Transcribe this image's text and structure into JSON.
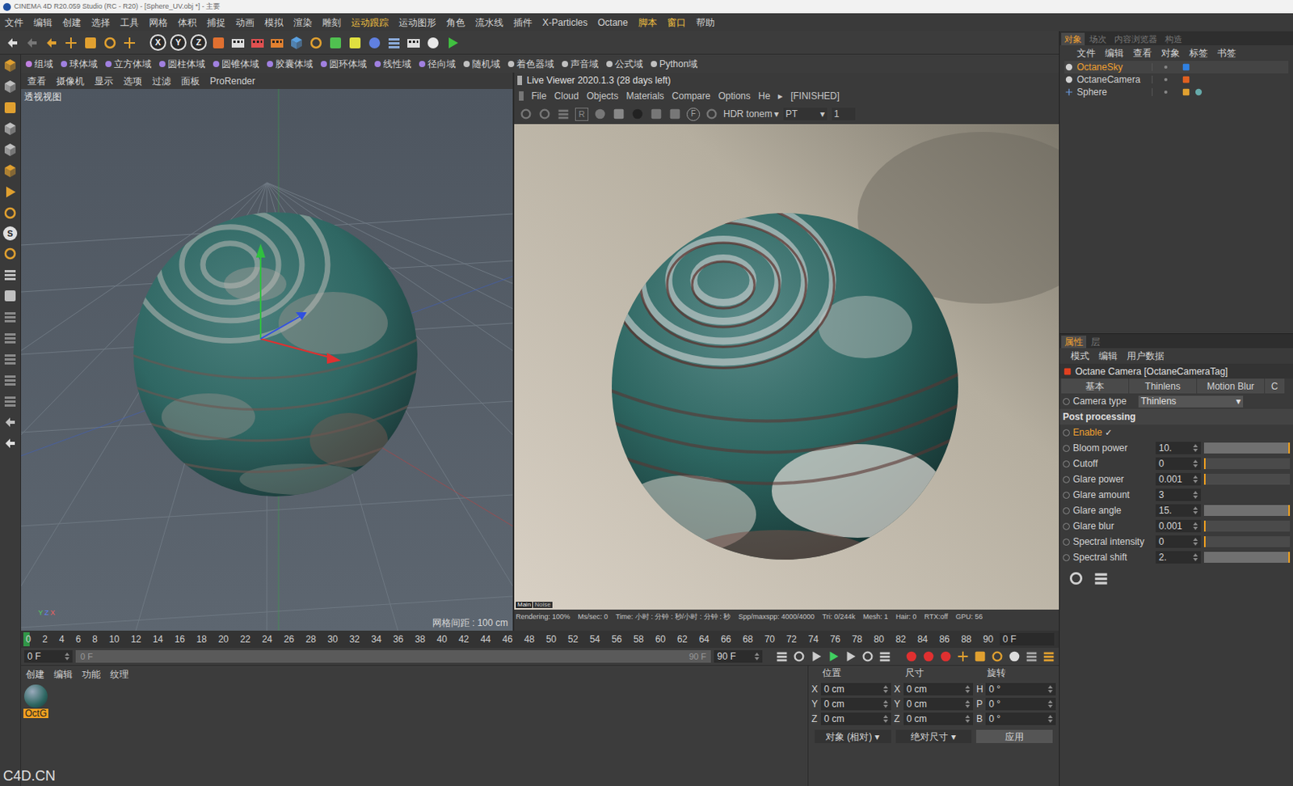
{
  "window": {
    "title": "CINEMA 4D R20.059 Studio (RC - R20) - [Sphere_UV.obj *] - 主要"
  },
  "menu": [
    {
      "label": "文件",
      "highlighted": false
    },
    {
      "label": "编辑",
      "highlighted": false
    },
    {
      "label": "创建",
      "highlighted": false
    },
    {
      "label": "选择",
      "highlighted": false
    },
    {
      "label": "工具",
      "highlighted": false
    },
    {
      "label": "网格",
      "highlighted": false
    },
    {
      "label": "体积",
      "highlighted": false
    },
    {
      "label": "捕捉",
      "highlighted": false
    },
    {
      "label": "动画",
      "highlighted": false
    },
    {
      "label": "模拟",
      "highlighted": false
    },
    {
      "label": "渲染",
      "highlighted": false
    },
    {
      "label": "雕刻",
      "highlighted": false
    },
    {
      "label": "运动跟踪",
      "highlighted": true
    },
    {
      "label": "运动图形",
      "highlighted": false
    },
    {
      "label": "角色",
      "highlighted": false
    },
    {
      "label": "流水线",
      "highlighted": false
    },
    {
      "label": "插件",
      "highlighted": false
    },
    {
      "label": "X-Particles",
      "highlighted": false
    },
    {
      "label": "Octane",
      "highlighted": false
    },
    {
      "label": "脚本",
      "highlighted": true
    },
    {
      "label": "窗口",
      "highlighted": true
    },
    {
      "label": "帮助",
      "highlighted": false
    }
  ],
  "main_toolbar": {
    "axis_buttons": [
      "X",
      "Y",
      "Z"
    ]
  },
  "field_bar": [
    "组域",
    "球体域",
    "立方体域",
    "圆柱体域",
    "圆锥体域",
    "胶囊体域",
    "圆环体域",
    "线性域",
    "径向域",
    "随机域",
    "着色器域",
    "声音域",
    "公式域",
    "Python域"
  ],
  "left_toolbar": {
    "s_button": "S"
  },
  "viewport": {
    "menu": [
      "查看",
      "摄像机",
      "显示",
      "选项",
      "过滤",
      "面板",
      "ProRender"
    ],
    "label": "透视视图",
    "grid_info": "网格间距 : 100 cm",
    "axis_labels": [
      "Y",
      "Z",
      "X"
    ]
  },
  "live_viewer": {
    "title": "Live Viewer 2020.1.3 (28 days left)",
    "menu": [
      "File",
      "Cloud",
      "Objects",
      "Materials",
      "Compare",
      "Options",
      "He",
      "▸",
      "[FINISHED]"
    ],
    "toolbar": {
      "r_button": "R",
      "f_button": "F",
      "tonemap": "HDR tonem",
      "tonemap_arrow": "▾",
      "kernel": "PT",
      "kernel_arrow": "▾",
      "value": "1"
    },
    "image_tabs": [
      {
        "label": "Main",
        "selected": true
      },
      {
        "label": "Noise",
        "selected": false
      }
    ],
    "status": [
      "Rendering: 100%",
      "Ms/sec: 0",
      "Time: 小时 : 分钟 : 秒/小时 : 分钟 : 秒",
      "Spp/maxspp: 4000/4000",
      "Tri: 0/244k",
      "Mesh: 1",
      "Hair: 0",
      "RTX:off",
      "GPU: 56"
    ]
  },
  "timeline": {
    "ticks": [
      "0",
      "2",
      "4",
      "6",
      "8",
      "10",
      "12",
      "14",
      "16",
      "18",
      "20",
      "22",
      "24",
      "26",
      "28",
      "30",
      "32",
      "34",
      "36",
      "38",
      "40",
      "42",
      "44",
      "46",
      "48",
      "50",
      "52",
      "54",
      "56",
      "58",
      "60",
      "62",
      "64",
      "66",
      "68",
      "70",
      "72",
      "74",
      "76",
      "78",
      "80",
      "82",
      "84",
      "86",
      "88",
      "90"
    ],
    "current": "0 F"
  },
  "playback": {
    "start": "0 F",
    "range_start": "0 F",
    "range_end": "90 F",
    "end": "90 F",
    "range_level": 1
  },
  "material_manager": {
    "menu": [
      "创建",
      "编辑",
      "功能",
      "纹理"
    ],
    "materials": [
      {
        "name": "OctG",
        "selected": true
      }
    ]
  },
  "coordinates": {
    "headers": [
      "位置",
      "尺寸",
      "旋转"
    ],
    "rows": [
      [
        {
          "axis": "X",
          "value": "0 cm"
        },
        {
          "axis": "X",
          "value": "0 cm"
        },
        {
          "axis": "H",
          "value": "0 °"
        }
      ],
      [
        {
          "axis": "Y",
          "value": "0 cm"
        },
        {
          "axis": "Y",
          "value": "0 cm"
        },
        {
          "axis": "P",
          "value": "0 °"
        }
      ],
      [
        {
          "axis": "Z",
          "value": "0 cm"
        },
        {
          "axis": "Z",
          "value": "0 cm"
        },
        {
          "axis": "B",
          "value": "0 °"
        }
      ]
    ],
    "buttons": [
      {
        "label": "对象 (相对)",
        "kind": "dropdown",
        "arrow": "▾"
      },
      {
        "label": "绝对尺寸",
        "kind": "dropdown",
        "arrow": "▾"
      },
      {
        "label": "应用",
        "kind": "button",
        "arrow": ""
      }
    ]
  },
  "object_manager": {
    "tabs": [
      {
        "label": "对象",
        "selected": true
      },
      {
        "label": "场次",
        "selected": false
      },
      {
        "label": "内容浏览器",
        "selected": false
      },
      {
        "label": "构造",
        "selected": false
      }
    ],
    "menu": [
      "文件",
      "编辑",
      "查看",
      "对象",
      "标签",
      "书签"
    ],
    "objects": [
      {
        "name": "OctaneSky",
        "selected": true
      },
      {
        "name": "OctaneCamera",
        "selected": false
      },
      {
        "name": "Sphere",
        "selected": false
      }
    ]
  },
  "attributes": {
    "tabs": [
      {
        "label": "属性",
        "selected": true
      },
      {
        "label": "层",
        "selected": false
      }
    ],
    "menu": [
      "模式",
      "编辑",
      "用户数据"
    ],
    "title": "Octane Camera [OctaneCameraTag]",
    "subtabs": [
      {
        "label": "基本",
        "selected": false
      },
      {
        "label": "Thinlens",
        "selected": false
      },
      {
        "label": "Motion Blur",
        "selected": false
      },
      {
        "label": "C",
        "selected": false
      }
    ],
    "camera_type": {
      "label": "Camera type",
      "value": "Thinlens",
      "arrow": "▾"
    },
    "section": "Post processing",
    "enable": {
      "label": "Enable",
      "checked": true,
      "mark": "✓"
    },
    "params": [
      {
        "label": "Bloom power",
        "value": "10.",
        "kind": "slider",
        "level": 1
      },
      {
        "label": "Cutoff",
        "value": "0",
        "kind": "slider",
        "level": 0
      },
      {
        "label": "Glare power",
        "value": "0.001",
        "kind": "slider",
        "level": 0
      },
      {
        "label": "Glare amount",
        "value": "3",
        "kind": "number",
        "level": 0
      },
      {
        "label": "Glare angle",
        "value": "15.",
        "kind": "slider",
        "level": 1
      },
      {
        "label": "Glare blur",
        "value": "0.001",
        "kind": "slider",
        "level": 0
      },
      {
        "label": "Spectral intensity",
        "value": "0",
        "kind": "slider",
        "level": 0
      },
      {
        "label": "Spectral shift",
        "value": "2.",
        "kind": "slider",
        "level": 1
      }
    ]
  },
  "watermark": "C4D.CN"
}
